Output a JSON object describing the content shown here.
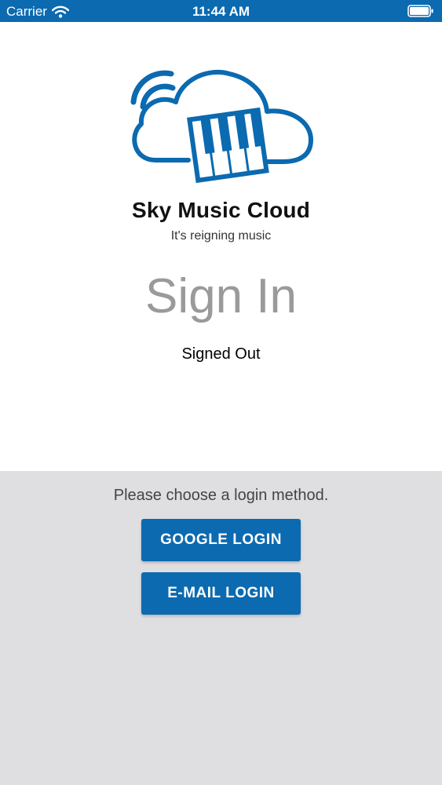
{
  "status_bar": {
    "carrier": "Carrier",
    "time": "11:44 AM",
    "icons": [
      "wifi-icon",
      "battery-icon"
    ]
  },
  "brand": {
    "name": "Sky Music Cloud",
    "tagline": "It's reigning music",
    "logo_icon": "cloud-piano-logo"
  },
  "page": {
    "title": "Sign In",
    "auth_status": "Signed Out"
  },
  "login": {
    "prompt": "Please choose a login method.",
    "google_label": "GOOGLE LOGIN",
    "email_label": "E-MAIL LOGIN"
  },
  "colors": {
    "primary": "#0b6ab0",
    "background": "#ffffff",
    "panel_background": "#dfdfe1",
    "title_gray": "#9a9a9a"
  }
}
